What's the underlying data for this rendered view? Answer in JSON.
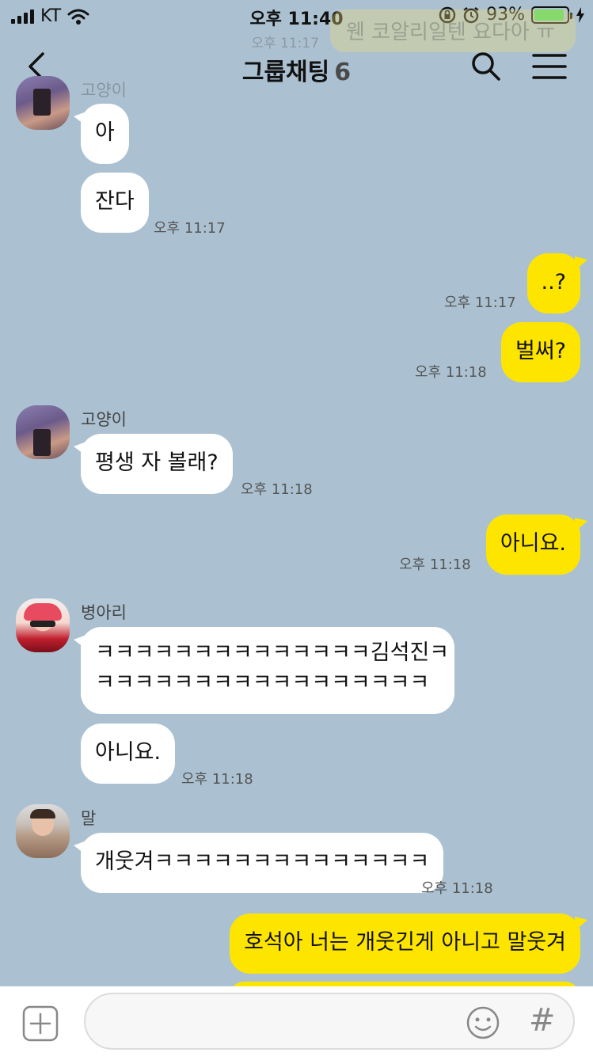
{
  "status": {
    "carrier": "KT",
    "time": "오후 11:40",
    "battery": "93%",
    "battery_level": 0.93
  },
  "ghost": {
    "text": "웬 코알리일텐 요다아 ㅠ",
    "time": "오후 11:17"
  },
  "header": {
    "title": "그룹채팅",
    "member_count": "6"
  },
  "messages": [
    {
      "sender": "고양이",
      "text": "아"
    },
    {
      "text": "잔다",
      "time": "오후 11:17"
    },
    {
      "text": "..?",
      "time": "오후 11:17"
    },
    {
      "text": "벌써?",
      "time": "오후 11:18"
    },
    {
      "sender": "고양이",
      "text": "평생 자 볼래?",
      "time": "오후 11:18"
    },
    {
      "text": "아니요.",
      "time": "오후 11:18"
    },
    {
      "sender": "병아리",
      "text_line1": "ㅋㅋㅋㅋㅋㅋㅋㅋㅋㅋㅋㅋㅋㅋ김석진ㅋ",
      "text_line2": "ㅋㅋㅋㅋㅋㅋㅋㅋㅋㅋㅋㅋㅋㅋㅋㅋㅋ"
    },
    {
      "text": "아니요.",
      "time": "오후 11:18"
    },
    {
      "sender": "말",
      "text": "개웃겨ㅋㅋㅋㅋㅋㅋㅋㅋㅋㅋㅋㅋㅋㅋ",
      "time": "오후 11:18"
    },
    {
      "text": "호석아 너는 개웃긴게 아니고 말웃겨"
    }
  ],
  "input": {
    "placeholder": ""
  },
  "colors": {
    "background": "#abc1d1",
    "my_bubble": "#fee500",
    "other_bubble": "#ffffff"
  }
}
